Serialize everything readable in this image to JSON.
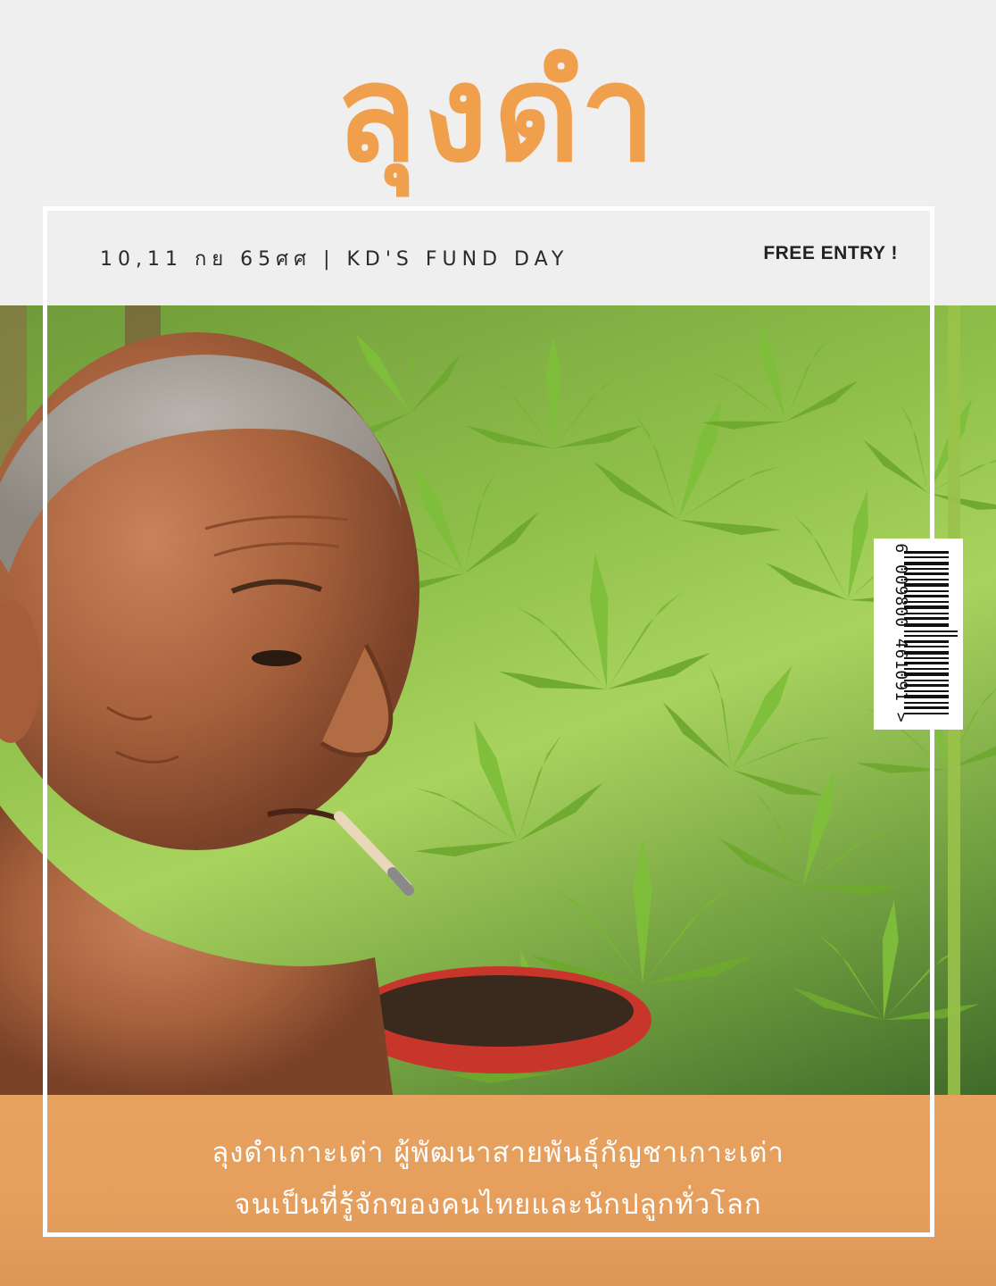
{
  "cover": {
    "title": "ลุงดำ",
    "issue_line": "10,11 กย 65ศศ | KD'S FUND DAY",
    "badge": "FREE ENTRY !",
    "caption_line1": "ลุงดำเกาะเต่า ผู้พัฒนาสายพันธุ์กัญชาเกาะเต่า",
    "caption_line2": "จนเป็นที่รู้จักของคนไทยและนักปลูกทั่วโลก"
  },
  "barcode": {
    "number": "6 009800 461091 >"
  },
  "colors": {
    "title": "#f0a04c",
    "band": "#e59e5c",
    "frame": "#ffffff",
    "background": "#efefef"
  }
}
